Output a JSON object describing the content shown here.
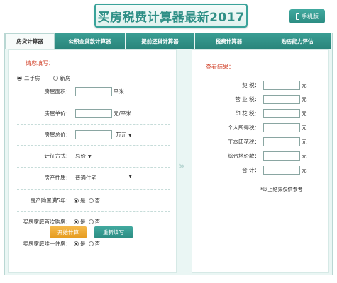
{
  "header": {
    "title": "买房税费计算器最新2017",
    "mobile_label": "手机版"
  },
  "tabs": [
    "房贷计算器",
    "公积金贷款计算器",
    "提前还贷计算器",
    "税费计算器",
    "购房能力评估"
  ],
  "form": {
    "heading": "请您填写：",
    "house_type": {
      "options": [
        "二手房",
        "新房"
      ],
      "selected": "二手房"
    },
    "area": {
      "label": "房屋面积：",
      "unit": "平米",
      "value": ""
    },
    "price": {
      "label": "房屋单价：",
      "unit": "元/平米",
      "value": ""
    },
    "total": {
      "label": "房屋总价：",
      "unit": "万元",
      "value": ""
    },
    "tax_method": {
      "label": "计征方式：",
      "value": "总价"
    },
    "property": {
      "label": "房产性质：",
      "value": "普通住宅"
    },
    "over5": {
      "label": "房产购置满5年：",
      "yes": "是",
      "no": "否",
      "selected": "是"
    },
    "first_buy": {
      "label": "买房家庭首次购房：",
      "yes": "是",
      "no": "否",
      "selected": "是"
    },
    "only_house": {
      "label": "卖房家庭唯一住房：",
      "yes": "是",
      "no": "否",
      "selected": "是"
    },
    "start_button": "开始计算",
    "reset_button": "重新填写"
  },
  "results": {
    "heading": "查看结果：",
    "items": [
      {
        "label": "契 税：",
        "unit": "元"
      },
      {
        "label": "营 业 税：",
        "unit": "元"
      },
      {
        "label": "印 花 税：",
        "unit": "元"
      },
      {
        "label": "个人所得税：",
        "unit": "元"
      },
      {
        "label": "工本印花税：",
        "unit": "元"
      },
      {
        "label": "综合地价款：",
        "unit": "元"
      },
      {
        "label": "合 计：",
        "unit": "元"
      }
    ],
    "note": "*以上结果仅供参考"
  },
  "colors": {
    "accent": "#2e8f86",
    "heading_red": "#d2432b",
    "start_orange": "#eea532"
  }
}
